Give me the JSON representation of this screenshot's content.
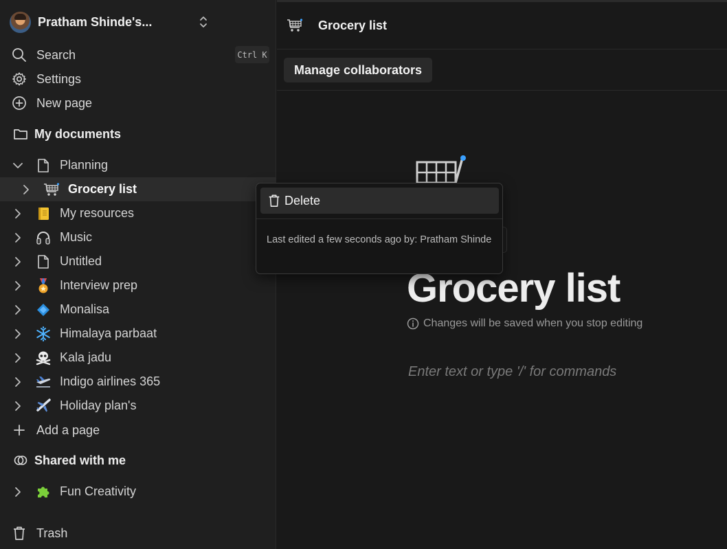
{
  "workspace": {
    "name": "Pratham Shinde's..."
  },
  "nav": {
    "search_label": "Search",
    "search_shortcut": "Ctrl K",
    "settings_label": "Settings",
    "new_page_label": "New page"
  },
  "sections": {
    "my_documents": "My documents",
    "shared_with_me": "Shared with me"
  },
  "tree": [
    {
      "label": "Planning",
      "icon": "page-icon",
      "expanded": true
    },
    {
      "label": "Grocery list",
      "icon": "shopping-cart-icon",
      "active": true
    },
    {
      "label": "My resources",
      "icon": "notebook-emoji"
    },
    {
      "label": "Music",
      "icon": "headphones-emoji"
    },
    {
      "label": "Untitled",
      "icon": "page-icon"
    },
    {
      "label": "Interview prep",
      "icon": "medal-emoji"
    },
    {
      "label": "Monalisa",
      "icon": "diamond-emoji"
    },
    {
      "label": "Himalaya parbaat",
      "icon": "snowflake-emoji"
    },
    {
      "label": "Kala jadu",
      "icon": "skull-crossbones-emoji"
    },
    {
      "label": "Indigo airlines 365",
      "icon": "airplane-departure-emoji"
    },
    {
      "label": "Holiday plan's",
      "icon": "airplane-emoji"
    }
  ],
  "add_page_label": "Add a page",
  "shared": [
    {
      "label": "Fun Creativity",
      "icon": "puzzle-emoji"
    }
  ],
  "trash_label": "Trash",
  "topbar": {
    "title": "Grocery list"
  },
  "collab_button": "Manage collaborators",
  "document": {
    "title": "Grocery list",
    "save_note": "Changes will be saved when you stop editing",
    "editor_placeholder": "Enter text or type '/' for commands"
  },
  "context_menu": {
    "delete_label": "Delete",
    "last_edited": "Last edited a few seconds ago by: Pratham Shinde"
  },
  "colors": {
    "sidebar_bg": "#1f1f1f",
    "main_bg": "#191919",
    "active_row": "#2c2c2c",
    "cart_accent": "#3aa0ff"
  }
}
